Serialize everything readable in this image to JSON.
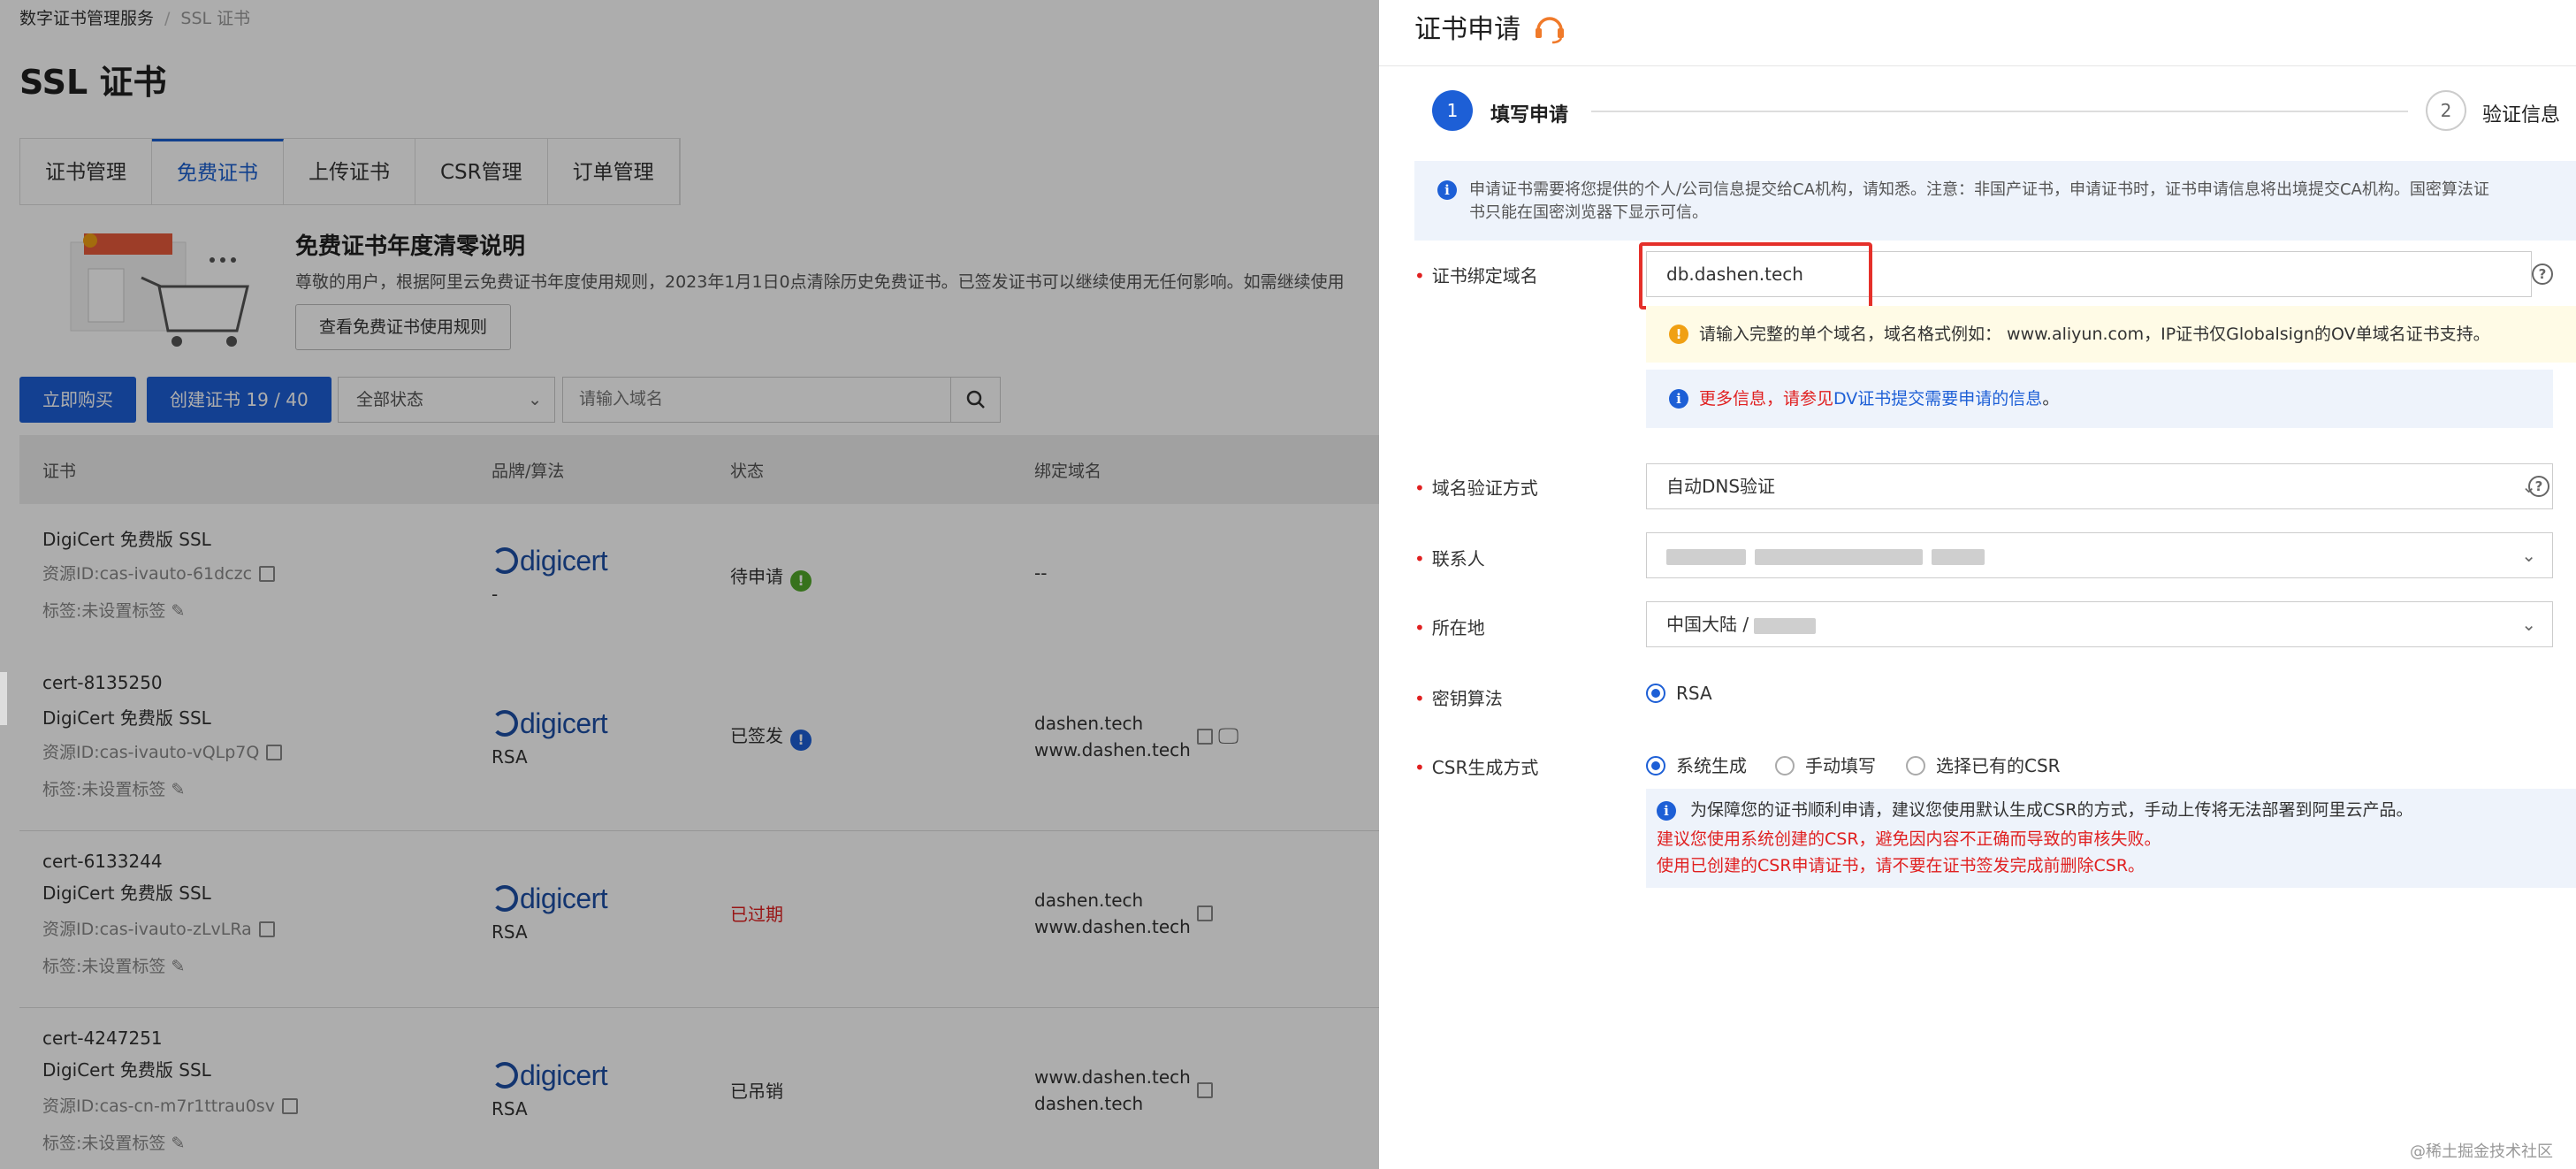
{
  "breadcrumb": {
    "root": "数字证书管理服务",
    "current": "SSL 证书"
  },
  "page_title": "SSL 证书",
  "tabs": [
    {
      "label": "证书管理",
      "active": false
    },
    {
      "label": "免费证书",
      "active": true
    },
    {
      "label": "上传证书",
      "active": false
    },
    {
      "label": "CSR管理",
      "active": false
    },
    {
      "label": "订单管理",
      "active": false
    }
  ],
  "notice": {
    "title": "免费证书年度清零说明",
    "text": "尊敬的用户，根据阿里云免费证书年度使用规则，2023年1月1日0点清除历史免费证书。已签发证书可以继续使用无任何影响。如需继续使用",
    "button": "查看免费证书使用规则"
  },
  "toolbar": {
    "buy_button": "立即购买",
    "create_button": "创建证书 19 / 40",
    "status_select": "全部状态",
    "search_placeholder": "请输入域名"
  },
  "table": {
    "headers": {
      "cert": "证书",
      "brand": "品牌/算法",
      "status": "状态",
      "domain": "绑定域名"
    },
    "rows": [
      {
        "id": "",
        "name": "DigiCert 免费版 SSL",
        "resource": "资源ID:cas-ivauto-61dczc",
        "tag": "标签:未设置标签",
        "brand": "digicert",
        "algo": "-",
        "status": "待申请",
        "status_color": "#52a82a",
        "domains": [
          "--",
          ""
        ]
      },
      {
        "id": "cert-8135250",
        "name": "DigiCert 免费版 SSL",
        "resource": "资源ID:cas-ivauto-vQLp7Q",
        "tag": "标签:未设置标签",
        "brand": "digicert",
        "algo": "RSA",
        "status": "已签发",
        "status_color": "#1d5fd6",
        "domains": [
          "dashen.tech",
          "www.dashen.tech"
        ]
      },
      {
        "id": "cert-6133244",
        "name": "DigiCert 免费版 SSL",
        "resource": "资源ID:cas-ivauto-zLvLRa",
        "tag": "标签:未设置标签",
        "brand": "digicert",
        "algo": "RSA",
        "status": "已过期",
        "status_color": "#e02020",
        "domains": [
          "dashen.tech",
          "www.dashen.tech"
        ]
      },
      {
        "id": "cert-4247251",
        "name": "DigiCert 免费版 SSL",
        "resource": "资源ID:cas-cn-m7r1ttrau0sv",
        "tag": "标签:未设置标签",
        "brand": "digicert",
        "algo": "RSA",
        "status": "已吊销",
        "status_color": "",
        "domains": [
          "www.dashen.tech",
          "dashen.tech"
        ]
      }
    ]
  },
  "drawer": {
    "title": "证书申请",
    "steps": [
      {
        "num": "1",
        "label": "填写申请"
      },
      {
        "num": "2",
        "label": "验证信息"
      }
    ],
    "info": {
      "line1": "申请证书需要将您提供的个人/公司信息提交给CA机构，请知悉。注意：非国产证书，申请证书时，证书申请信息将出境提交CA机构。国密算法证",
      "line2": "书只能在国密浏览器下显示可信。"
    },
    "fields": {
      "domain_label": "证书绑定域名",
      "domain_value": "db.dashen.tech",
      "domain_hint": "请输入完整的单个域名，域名格式例如： www.aliyun.com，IP证书仅Globalsign的OV单域名证书支持。",
      "more_info_prefix": "更多信息，请参见",
      "more_info_link": "DV证书提交需要申请的信息",
      "more_info_suffix": "。",
      "verify_label": "域名验证方式",
      "verify_value": "自动DNS验证",
      "contact_label": "联系人",
      "location_label": "所在地",
      "location_value": "中国大陆 /",
      "key_label": "密钥算法",
      "key_option": "RSA",
      "csr_label": "CSR生成方式",
      "csr_options": [
        "系统生成",
        "手动填写",
        "选择已有的CSR"
      ],
      "csr_note1": "为保障您的证书顺利申请，建议您使用默认生成CSR的方式，手动上传将无法部署到阿里云产品。",
      "csr_note2": "建议您使用系统创建的CSR，避免因内容不正确而导致的审核失败。",
      "csr_note3": "使用已创建的CSR申请证书，请不要在证书签发完成前删除CSR。"
    }
  },
  "watermark": "@稀土掘金技术社区",
  "colors": {
    "primary": "#1d5fd6",
    "danger": "#e02020",
    "warning": "#f0a014",
    "success": "#52a82a"
  }
}
